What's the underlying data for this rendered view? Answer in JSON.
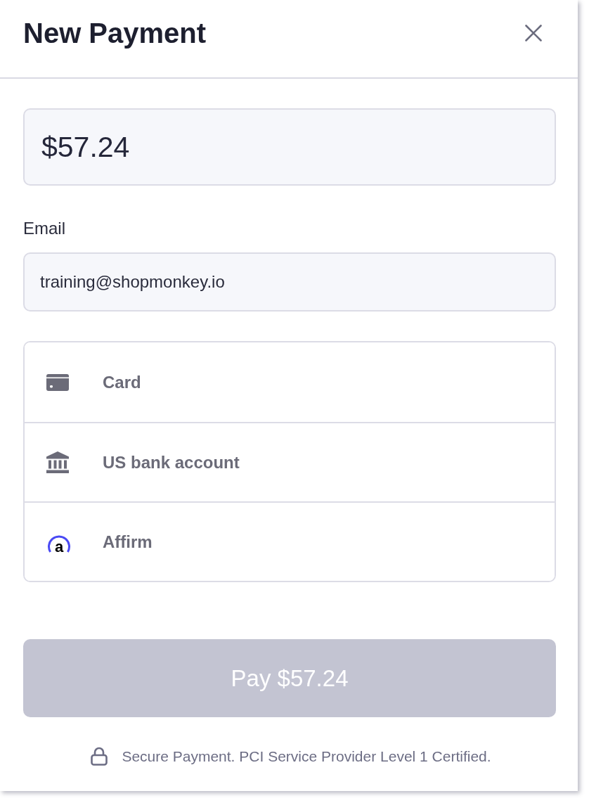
{
  "header": {
    "title": "New Payment"
  },
  "amount": {
    "value": "$57.24"
  },
  "email": {
    "label": "Email",
    "value": "training@shopmonkey.io"
  },
  "payment_methods": [
    {
      "kind": "card",
      "label": "Card",
      "selected": false
    },
    {
      "kind": "bank",
      "label": "US bank account",
      "selected": false
    },
    {
      "kind": "affirm",
      "label": "Affirm",
      "logo_text": "a",
      "selected": false
    }
  ],
  "pay_button": {
    "label": "Pay $57.24",
    "disabled": true
  },
  "footer": {
    "text": "Secure Payment. PCI Service Provider Level 1 Certified."
  }
}
